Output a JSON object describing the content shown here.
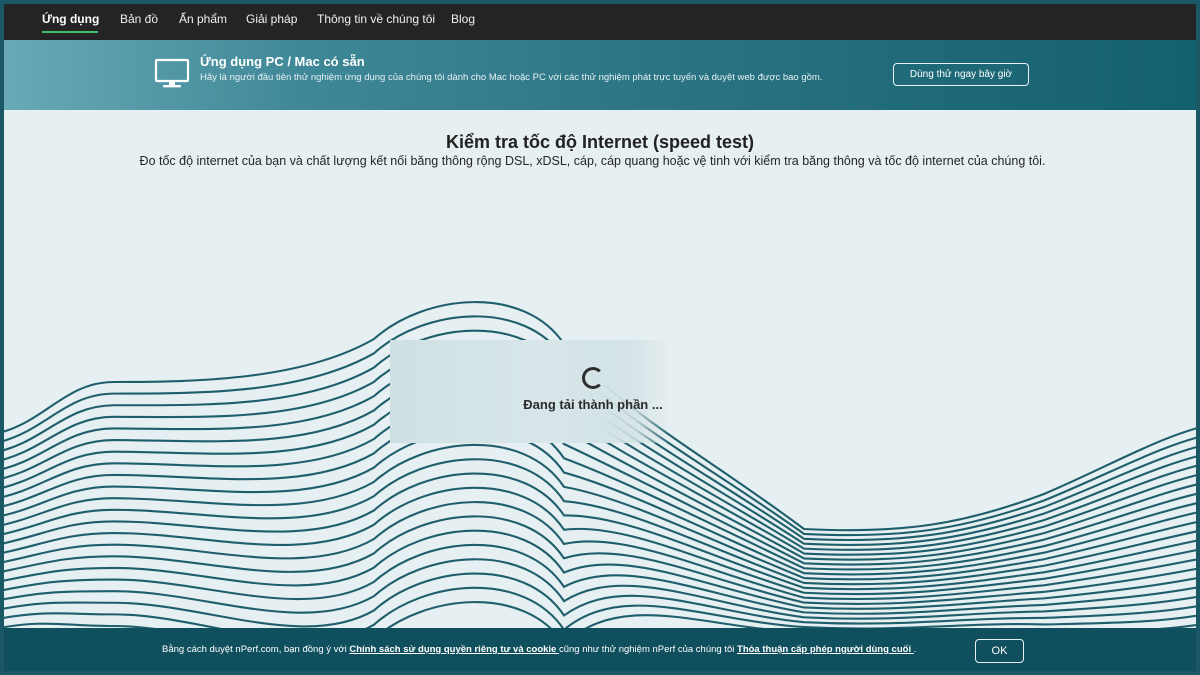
{
  "nav": {
    "items": [
      {
        "label": "Ứng dụng",
        "active": true
      },
      {
        "label": "Bản đồ",
        "active": false
      },
      {
        "label": "Ấn phẩm",
        "active": false
      },
      {
        "label": "Giải pháp",
        "active": false
      },
      {
        "label": "Thông tin về chúng tôi",
        "active": false
      },
      {
        "label": "Blog",
        "active": false
      }
    ]
  },
  "banner": {
    "icon": "monitor-icon",
    "title": "Ứng dụng PC / Mac có sẵn",
    "description": "Hãy là người đầu tiên thử nghiệm ứng dụng của chúng tôi dành cho Mac hoặc PC với các thử nghiệm phát trực tuyến và duyệt web được bao gồm.",
    "button_label": "Dùng thử ngay bây giờ"
  },
  "main": {
    "title": "Kiểm tra tốc độ Internet (speed test)",
    "subtitle": "Đo tốc độ internet của bạn và chất lượng kết nối băng thông rộng DSL, xDSL, cáp, cáp quang hoặc vệ tinh với kiểm tra băng thông và tốc độ internet của chúng tôi.",
    "loading_text": "Đang tải thành phần ..."
  },
  "cookie": {
    "text_before": "Bằng cách duyệt nPerf.com, bạn đồng ý với ",
    "privacy_link": "Chính sách sử dụng quyền riêng tư và cookie ",
    "text_middle": "cũng như thử nghiệm nPerf của chúng tôi ",
    "eula_link": "Thỏa thuận cấp phép người dùng cuối ",
    "text_after": ".",
    "ok_label": "OK"
  },
  "colors": {
    "accent": "#3fc06a",
    "wave": "#1f5f6c",
    "cookie_bg": "#10505e",
    "nav_bg": "#242424"
  }
}
